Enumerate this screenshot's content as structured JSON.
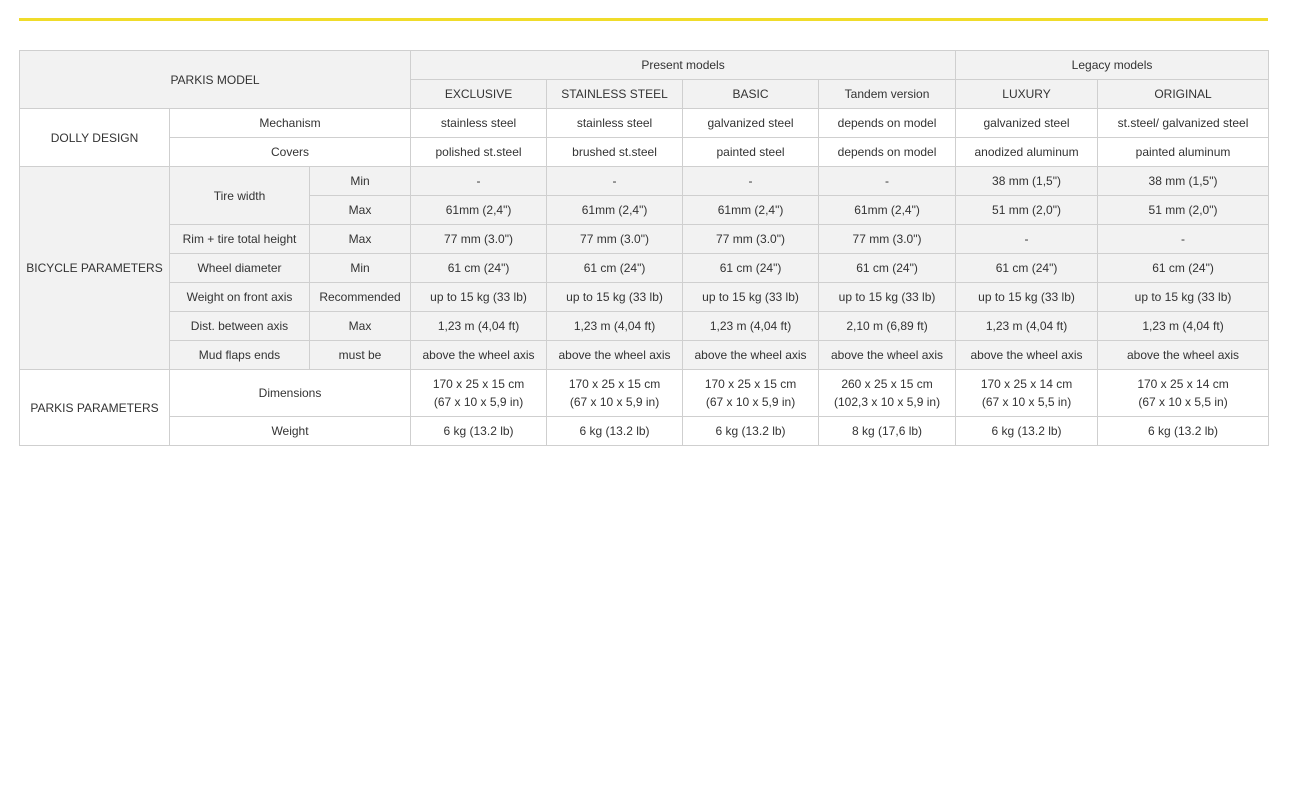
{
  "colors": {
    "accent_rule": "#f0dc2a",
    "border": "#cfcfcf",
    "shaded_row": "#f2f2f2",
    "text": "#333333"
  },
  "table": {
    "header": {
      "model_label": "PARKIS MODEL",
      "present_group": "Present models",
      "legacy_group": "Legacy models",
      "models": [
        "EXCLUSIVE",
        "STAINLESS STEEL",
        "BASIC",
        "Tandem version",
        "LUXURY",
        "ORIGINAL"
      ]
    },
    "sections": {
      "dolly": "DOLLY DESIGN",
      "bicycle": "BICYCLE PARAMETERS",
      "parkis": "PARKIS PARAMETERS"
    },
    "rows": [
      {
        "label": "Mechanism",
        "qualifier": "",
        "values": [
          "stainless steel",
          "stainless steel",
          "galvanized steel",
          "depends on model",
          "galvanized steel",
          "st.steel/ galvanized steel"
        ]
      },
      {
        "label": "Covers",
        "qualifier": "",
        "values": [
          "polished st.steel",
          "brushed st.steel",
          "painted steel",
          "depends on model",
          "anodized aluminum",
          "painted aluminum"
        ]
      },
      {
        "label": "Tire width",
        "qualifier": "Min",
        "values": [
          "-",
          "-",
          "-",
          "-",
          "38 mm (1,5\")",
          "38 mm (1,5\")"
        ]
      },
      {
        "label": "",
        "qualifier": "Max",
        "values": [
          "61mm (2,4\")",
          "61mm (2,4\")",
          "61mm (2,4\")",
          "61mm (2,4\")",
          "51 mm (2,0\")",
          "51 mm (2,0\")"
        ]
      },
      {
        "label": "Rim + tire total height",
        "qualifier": "Max",
        "values": [
          "77 mm (3.0\")",
          "77 mm (3.0\")",
          "77 mm (3.0\")",
          "77 mm (3.0\")",
          "-",
          "-"
        ]
      },
      {
        "label": "Wheel diameter",
        "qualifier": "Min",
        "values": [
          "61 cm (24\")",
          "61 cm (24\")",
          "61 cm (24\")",
          "61 cm (24\")",
          "61 cm (24\")",
          "61 cm (24\")"
        ]
      },
      {
        "label": "Weight on front axis",
        "qualifier": "Recommended",
        "values": [
          "up to 15 kg (33 lb)",
          "up to 15 kg (33 lb)",
          "up to 15 kg (33 lb)",
          "up to 15 kg (33 lb)",
          "up to 15 kg (33 lb)",
          "up to 15 kg (33 lb)"
        ]
      },
      {
        "label": "Dist. between axis",
        "qualifier": "Max",
        "values": [
          "1,23 m (4,04 ft)",
          "1,23 m (4,04 ft)",
          "1,23 m (4,04 ft)",
          "2,10 m (6,89 ft)",
          "1,23 m (4,04 ft)",
          "1,23 m (4,04 ft)"
        ]
      },
      {
        "label": "Mud flaps ends",
        "qualifier": "must be",
        "values": [
          "above the wheel axis",
          "above the wheel axis",
          "above the wheel axis",
          "above the wheel axis",
          "above the wheel axis",
          "above the wheel axis"
        ]
      },
      {
        "label": "Dimensions",
        "qualifier": "",
        "values": [
          [
            "170 x 25 x 15 cm",
            "(67 x 10 x 5,9 in)"
          ],
          [
            "170 x 25 x 15 cm",
            "(67 x 10 x 5,9 in)"
          ],
          [
            "170 x 25 x 15 cm",
            "(67 x 10 x 5,9 in)"
          ],
          [
            "260 x 25 x 15 cm",
            "(102,3 x 10 x 5,9 in)"
          ],
          [
            "170 x 25 x 14 cm",
            "(67 x 10 x 5,5 in)"
          ],
          [
            "170 x 25 x 14 cm",
            "(67 x 10 x 5,5 in)"
          ]
        ]
      },
      {
        "label": "Weight",
        "qualifier": "",
        "values": [
          "6 kg (13.2 lb)",
          "6 kg (13.2 lb)",
          "6 kg (13.2 lb)",
          "8 kg (17,6 lb)",
          "6 kg (13.2 lb)",
          "6 kg (13.2 lb)"
        ]
      }
    ]
  }
}
